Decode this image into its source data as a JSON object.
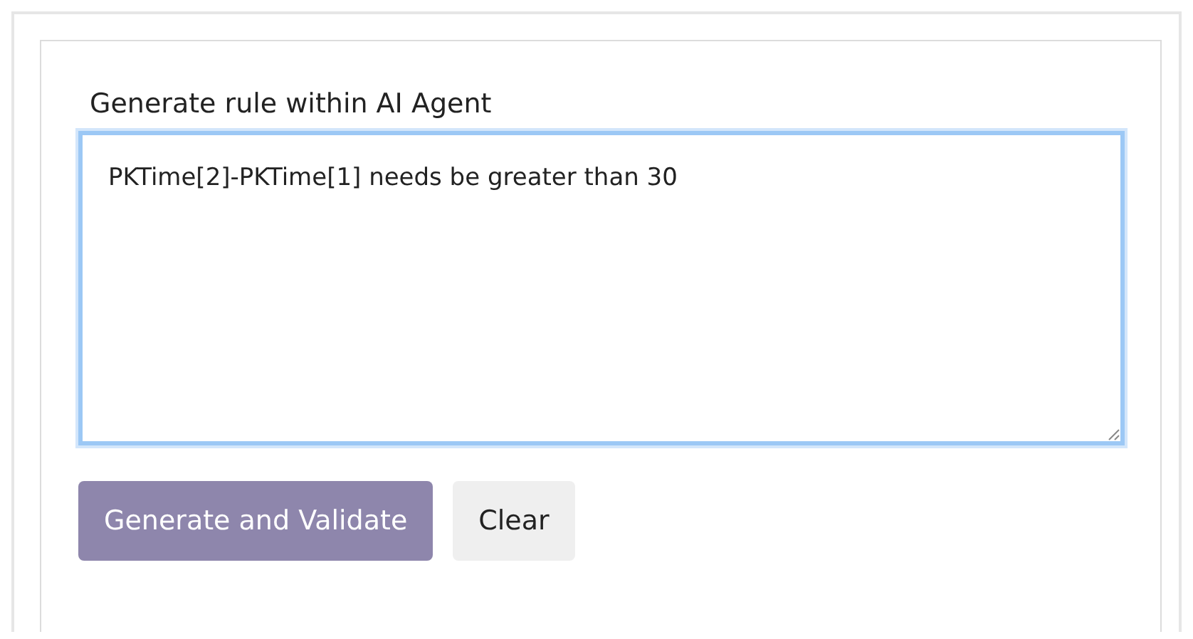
{
  "form": {
    "label": "Generate rule within AI Agent",
    "rule_field": {
      "value": "PKTime[2]-PKTime[1] needs be greater than 30",
      "focused": true
    },
    "buttons": [
      {
        "label": "Generate and Validate",
        "kind": "primary"
      },
      {
        "label": "Clear",
        "kind": "secondary"
      }
    ]
  }
}
